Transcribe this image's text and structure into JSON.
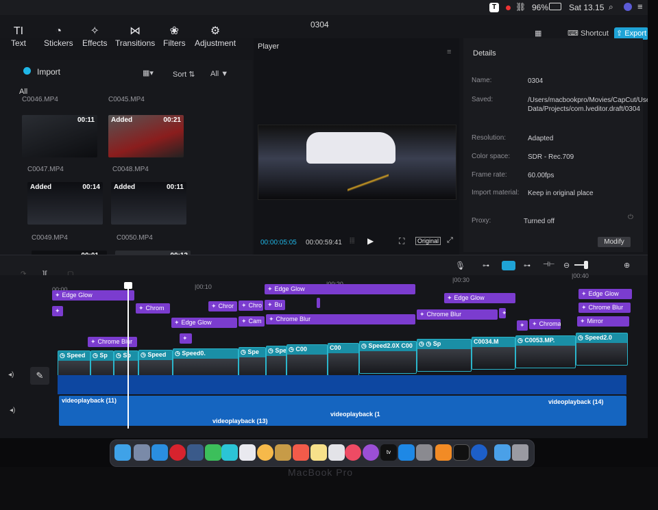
{
  "menubar": {
    "battery": "96%",
    "clock": "Sat 13.15"
  },
  "titlebar": {
    "project": "0304",
    "shortcut": "Shortcut",
    "export": "Export"
  },
  "toolbar": {
    "items": [
      {
        "icon": "text-icon",
        "label": "Text"
      },
      {
        "icon": "sticker-icon",
        "label": "Stickers"
      },
      {
        "icon": "effects-icon",
        "label": "Effects"
      },
      {
        "icon": "transitions-icon",
        "label": "Transitions"
      },
      {
        "icon": "filters-icon",
        "label": "Filters"
      },
      {
        "icon": "adjustment-icon",
        "label": "Adjustment"
      }
    ]
  },
  "media": {
    "import": "Import",
    "sort": "Sort",
    "all_filter": "All",
    "all_label": "All",
    "clips": [
      {
        "name": "C0046.MP4",
        "duration": "",
        "added": ""
      },
      {
        "name": "C0045.MP4",
        "duration": "",
        "added": ""
      },
      {
        "name": "C0047.MP4",
        "duration": "00:11",
        "added": ""
      },
      {
        "name": "C0048.MP4",
        "duration": "00:21",
        "added": "Added"
      },
      {
        "name": "C0049.MP4",
        "duration": "00:14",
        "added": "Added"
      },
      {
        "name": "C0050.MP4",
        "duration": "00:11",
        "added": "Added"
      },
      {
        "name": "",
        "duration": "00:01",
        "added": ""
      },
      {
        "name": "",
        "duration": "00:12",
        "added": ""
      }
    ]
  },
  "player": {
    "label": "Player",
    "current_time": "00:00:05:05",
    "total_time": "00:00:59:41",
    "original": "Original"
  },
  "details": {
    "title": "Details",
    "rows": [
      {
        "label": "Name:",
        "value": "0304"
      },
      {
        "label": "Saved:",
        "value": "/Users/macbookpro/Movies/CapCut/User Data/Projects/com.lveditor.draft/0304"
      },
      {
        "label": "Resolution:",
        "value": "Adapted"
      },
      {
        "label": "Color space:",
        "value": "SDR - Rec.709"
      },
      {
        "label": "Frame rate:",
        "value": "60.00fps"
      },
      {
        "label": "Import material:",
        "value": "Keep in original place"
      },
      {
        "label": "Proxy:",
        "value": "Turned off"
      }
    ],
    "modify": "Modify"
  },
  "ruler": {
    "ticks": [
      "00:00",
      "|00:10",
      "|00:20",
      "|00:30",
      "|00:40"
    ]
  },
  "effects": [
    {
      "label": "Edge Glow"
    },
    {
      "label": "Edge Glow"
    },
    {
      "label": "Edge Glow"
    },
    {
      "label": "Edge Glow"
    },
    {
      "label": "Chrom"
    },
    {
      "label": "Chror"
    },
    {
      "label": "Chro"
    },
    {
      "label": "Bu"
    },
    {
      "label": "Chrome Blur"
    },
    {
      "label": "Edge Glow"
    },
    {
      "label": "Cam"
    },
    {
      "label": "Chrome Blur"
    },
    {
      "label": "Chrome Blur"
    },
    {
      "label": "Chrome Blur"
    },
    {
      "label": "Chromat"
    },
    {
      "label": "Mirror"
    }
  ],
  "clips": [
    {
      "label": "Speed"
    },
    {
      "label": "Sp"
    },
    {
      "label": "Sp"
    },
    {
      "label": "Speed"
    },
    {
      "label": "Speed0."
    },
    {
      "label": "Spe"
    },
    {
      "label": "Spe"
    },
    {
      "label": "C00"
    },
    {
      "label": "C00"
    },
    {
      "label": "Speed2.0X C00"
    },
    {
      "label": "Sp"
    },
    {
      "label": "C0034.M"
    },
    {
      "label": "C0053.MP."
    },
    {
      "label": "Speed2.0"
    }
  ],
  "audio": {
    "track1": "videoplayback (11)",
    "track2": "videoplayback (13)",
    "track3": "videoplayback (1",
    "track4": "videoplayback (14)"
  },
  "laptop": {
    "brand": "MacBook Pro"
  }
}
